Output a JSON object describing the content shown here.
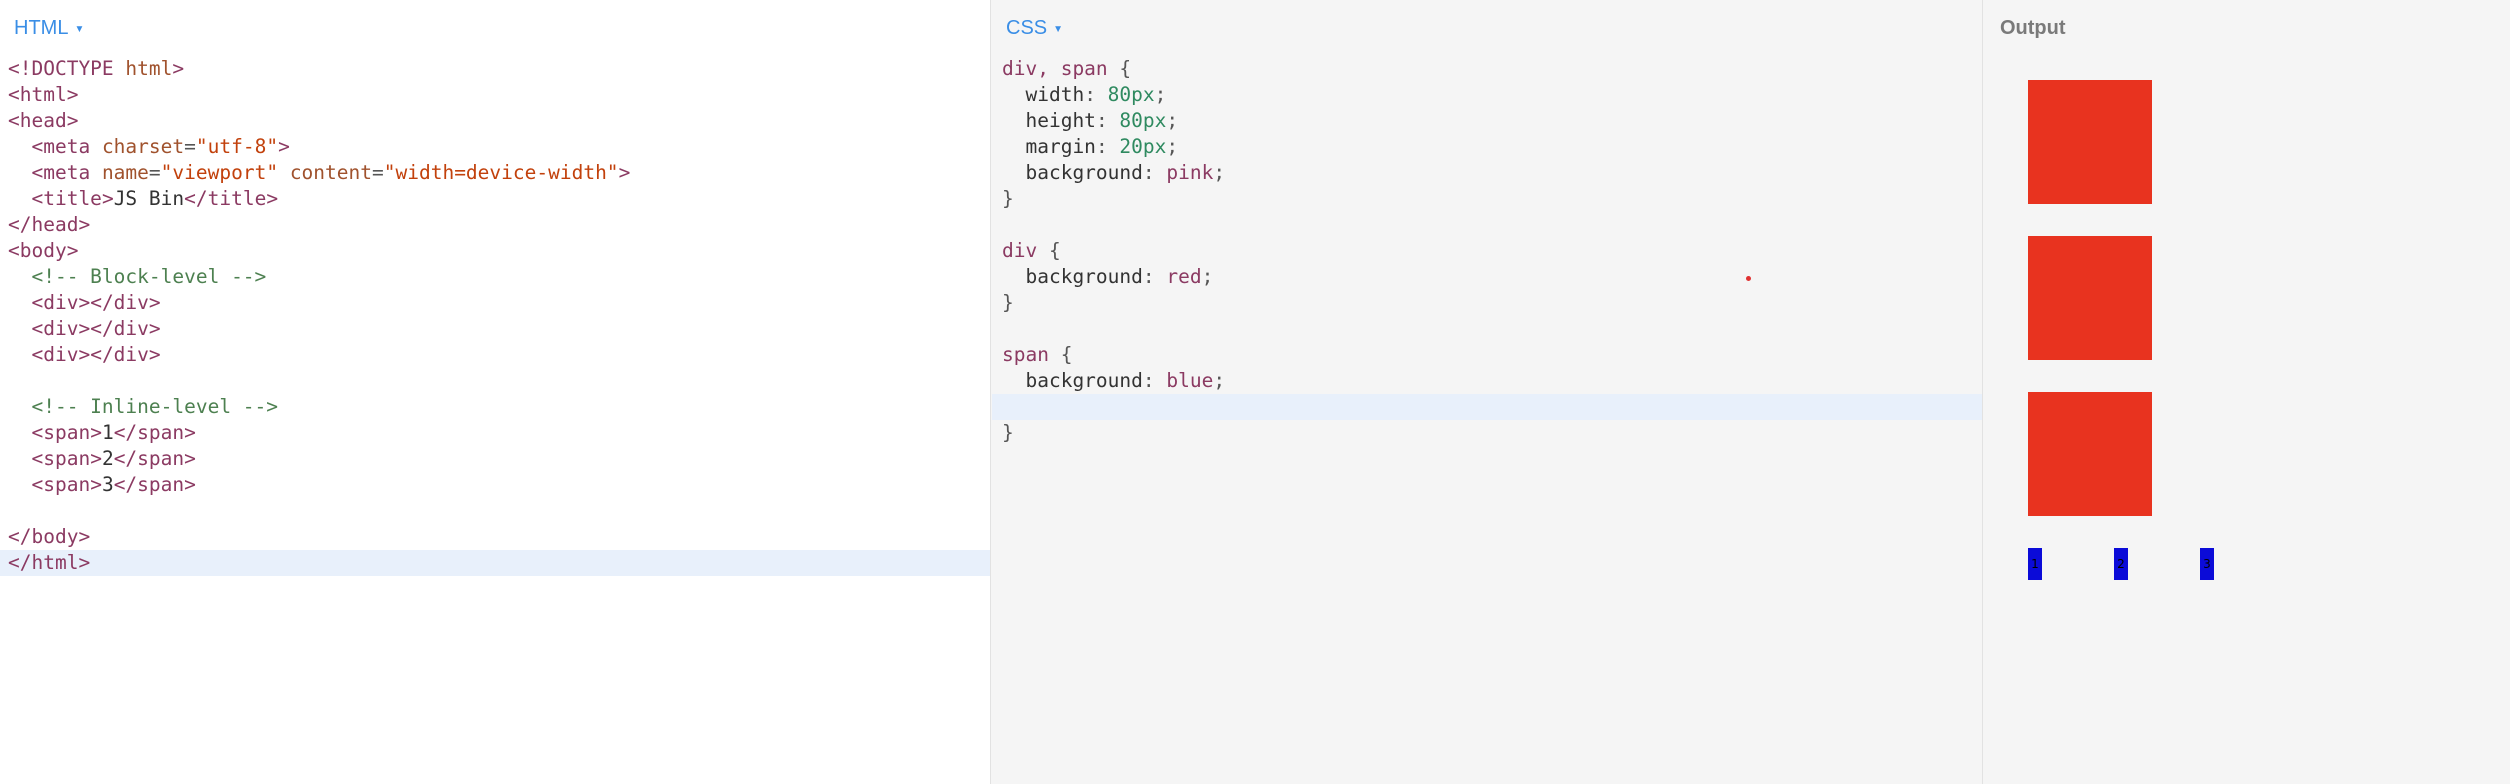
{
  "html_panel": {
    "title": "HTML",
    "lines": [
      "<!DOCTYPE html>",
      "<html>",
      "<head>",
      "  <meta charset=\"utf-8\">",
      "  <meta name=\"viewport\" content=\"width=device-width\">",
      "  <title>JS Bin</title>",
      "</head>",
      "<body>",
      "  <!-- Block-level -->",
      "  <div></div>",
      "  <div></div>",
      "  <div></div>",
      "",
      "  <!-- Inline-level -->",
      "  <span>1</span>",
      "  <span>2</span>",
      "  <span>3</span>",
      "",
      "</body>",
      "</html>"
    ]
  },
  "css_panel": {
    "title": "CSS",
    "lines": [
      "div, span {",
      "  width: 80px;",
      "  height: 80px;",
      "  margin: 20px;",
      "  background: pink;",
      "}",
      "",
      "div {",
      "  background: red;",
      "}",
      "",
      "span {",
      "  background: blue;",
      "",
      "}"
    ]
  },
  "output_panel": {
    "title": "Output",
    "divs": 3,
    "spans": [
      "1",
      "2",
      "3"
    ],
    "colors": {
      "div": "#e8331f",
      "span": "#0b0bd8"
    }
  },
  "colors": {
    "accent": "#3a8ee6",
    "active_line": "#e8f0fb"
  }
}
